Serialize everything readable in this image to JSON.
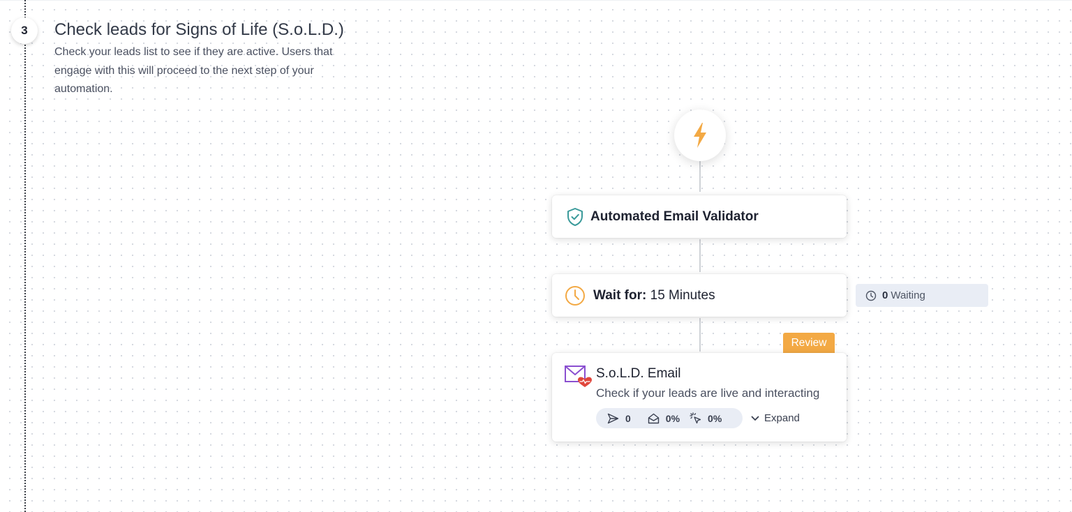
{
  "step": {
    "number": "3",
    "title": "Check leads for Signs of Life (S.o.L.D.)",
    "description": "Check your leads list to see if they are active. Users that engage with this will proceed to the next step of your automation."
  },
  "flow": {
    "trigger_icon": "lightning-bolt-icon",
    "validator": {
      "icon": "shield-check-icon",
      "title": "Automated Email Validator"
    },
    "wait": {
      "icon": "clock-icon",
      "label": "Wait for:",
      "value": "15 Minutes",
      "waiting_count": "0",
      "waiting_label": "Waiting"
    },
    "email": {
      "badge": "Review",
      "icon": "email-heart-icon",
      "title": "S.o.L.D. Email",
      "description": "Check if your leads are live and interacting",
      "stats": {
        "sent": "0",
        "opened": "0%",
        "clicked": "0%"
      },
      "expand_label": "Expand"
    }
  },
  "colors": {
    "accent_orange": "#f3a944",
    "validator_teal": "#3a9a9a",
    "email_purple": "#8a4fd0",
    "heart_red": "#e0463c",
    "chip_background": "#e9edf5"
  }
}
